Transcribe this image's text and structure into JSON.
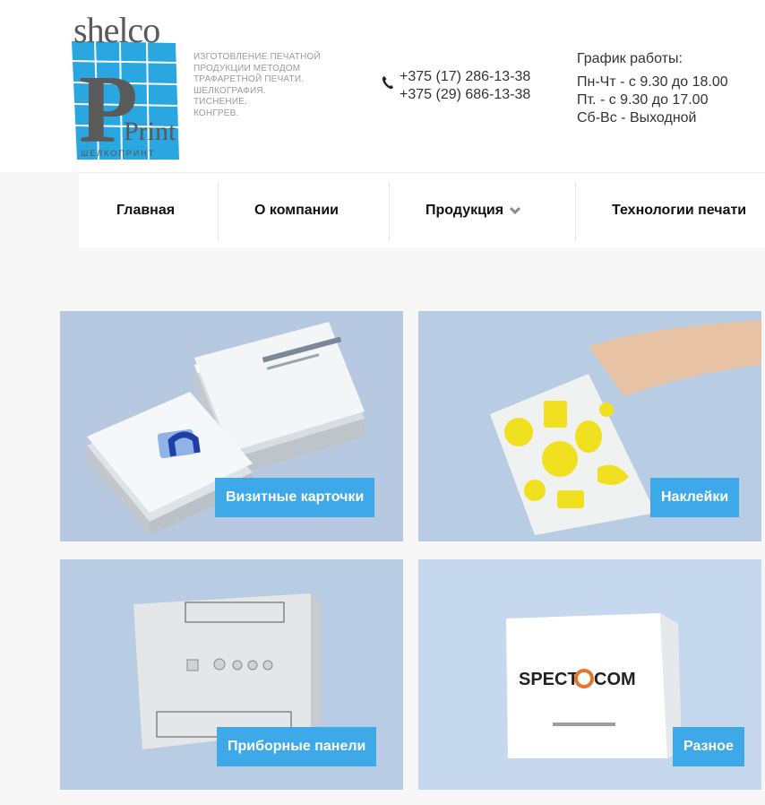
{
  "brand": {
    "logo_word": "shelco",
    "logo_subtitle": "ШЕЛКОПРИНТ",
    "logo_print": "Print",
    "tagline": [
      "Изготовление печатной",
      "продукции методом",
      "трафаретной печати.",
      "Шелкография.",
      "Тиснение.",
      "Конгрев."
    ]
  },
  "contacts": {
    "phones": [
      "+375 (17) 286-13-38",
      "+375 (29) 686-13-38"
    ]
  },
  "schedule": {
    "title": "График работы:",
    "lines": [
      "Пн-Чт - с 9.30 до 18.00",
      "Пт. - с 9.30 до 17.00",
      "Сб-Вс - Выходной"
    ]
  },
  "nav": {
    "items": [
      {
        "label": "Главная"
      },
      {
        "label": "О компании"
      },
      {
        "label": "Продукция"
      },
      {
        "label": "Технологии печати"
      }
    ]
  },
  "products": [
    {
      "label": "Визитные карточки"
    },
    {
      "label": "Наклейки"
    },
    {
      "label": "Приборные панели"
    },
    {
      "label": "Разное"
    }
  ],
  "colors": {
    "accent": "#3da9e8",
    "logo_blue": "#2aa7e0",
    "tile_bg": "#b8cce3"
  }
}
